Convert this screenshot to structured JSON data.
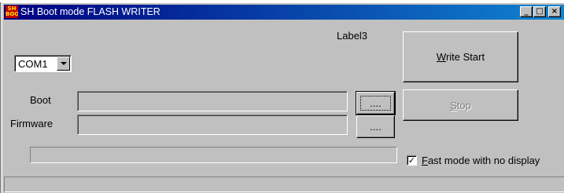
{
  "window": {
    "title": "SH Boot mode FLASH WRITER",
    "icon_text": "SH BOOT",
    "minimize_glyph": "_",
    "maximize_glyph": "□",
    "close_glyph": "×"
  },
  "label3": "Label3",
  "port": {
    "selected": "COM1"
  },
  "boot": {
    "label": "Boot",
    "value": "",
    "browse_label": "...."
  },
  "firmware": {
    "label": "Firmware",
    "value": "",
    "browse_label": "...."
  },
  "buttons": {
    "write_start": {
      "mnemonic": "W",
      "rest": "rite Start"
    },
    "stop": {
      "mnemonic": "S",
      "rest": "top"
    }
  },
  "fast_mode": {
    "checked": true,
    "check_glyph": "✓",
    "mnemonic": "F",
    "rest": "ast mode with no display"
  },
  "progress": {
    "value": 0
  },
  "status": {
    "text": ""
  },
  "colors": {
    "face": "#c0c0c0",
    "title_start": "#000080",
    "title_end": "#1084d0",
    "disabled_text": "#808080"
  }
}
